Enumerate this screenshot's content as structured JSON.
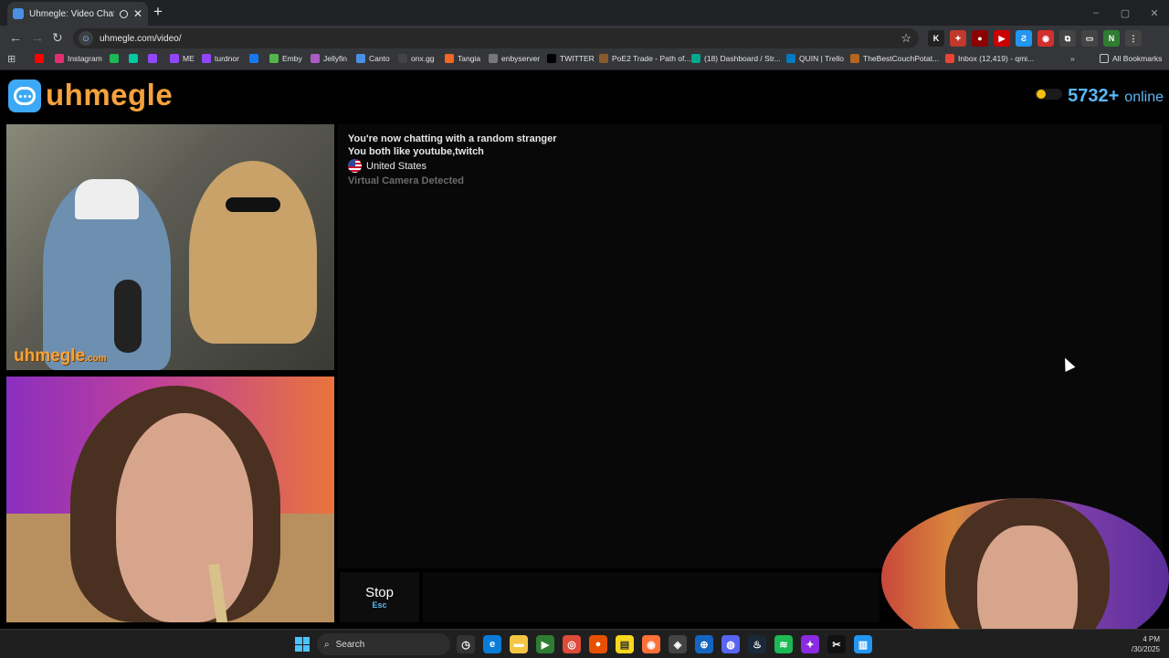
{
  "browser": {
    "tab_title": "Uhmegle: Video Chat | Ran",
    "url": "uhmegle.com/video/",
    "window_controls": [
      "–",
      "▢",
      "✕"
    ],
    "bookmarks": [
      {
        "label": "",
        "color": "#ff0000"
      },
      {
        "label": "Instagram",
        "color": "#e1306c"
      },
      {
        "label": "",
        "color": "#1db954"
      },
      {
        "label": "",
        "color": "#00c8a0"
      },
      {
        "label": "",
        "color": "#9146ff"
      },
      {
        "label": "ME",
        "color": "#9146ff"
      },
      {
        "label": "turdnor",
        "color": "#9146ff"
      },
      {
        "label": "",
        "color": "#1877f2"
      },
      {
        "label": "Emby",
        "color": "#52b54b"
      },
      {
        "label": "Jellyfin",
        "color": "#aa5cc3"
      },
      {
        "label": "Canto",
        "color": "#4a90e2"
      },
      {
        "label": "onx.gg",
        "color": "#444"
      },
      {
        "label": "Tangia",
        "color": "#f26522"
      },
      {
        "label": "enbyserver",
        "color": "#777"
      },
      {
        "label": "TWITTER",
        "color": "#000"
      },
      {
        "label": "PoE2 Trade - Path of...",
        "color": "#8b5a2b"
      },
      {
        "label": "(18) Dashboard / Str...",
        "color": "#00a88f"
      },
      {
        "label": "QUIN | Trello",
        "color": "#0079bf"
      },
      {
        "label": "TheBestCouchPotat...",
        "color": "#b5651d"
      },
      {
        "label": "Inbox (12,419) - qmi...",
        "color": "#ea4335"
      }
    ],
    "all_bookmarks": "All Bookmarks",
    "extensions": [
      {
        "glyph": "K",
        "color": "#222"
      },
      {
        "glyph": "✦",
        "color": "#c0392b"
      },
      {
        "glyph": "●",
        "color": "#8b0000"
      },
      {
        "glyph": "▶",
        "color": "#cc0000"
      },
      {
        "glyph": "Ƨ",
        "color": "#2196f3"
      },
      {
        "glyph": "◉",
        "color": "#d32f2f"
      },
      {
        "glyph": "⧉",
        "color": "#444"
      },
      {
        "glyph": "▭",
        "color": "#444"
      },
      {
        "glyph": "N",
        "color": "#2e7d32"
      },
      {
        "glyph": "⋮",
        "color": "#444"
      }
    ]
  },
  "site": {
    "logo_text": "uhmegle",
    "online_count": "5732+",
    "online_label": "online"
  },
  "chat": {
    "line1": "You're now chatting with a random stranger",
    "line2": "You both like youtube,twitch",
    "country": "United States",
    "notice": "Virtual Camera Detected"
  },
  "video": {
    "watermark": "uhmegle",
    "watermark_suffix": ".com"
  },
  "controls": {
    "stop_label": "Stop",
    "stop_key": "Esc"
  },
  "taskbar": {
    "search_label": "Search",
    "time": "4 PM",
    "date": "/30/2025"
  }
}
